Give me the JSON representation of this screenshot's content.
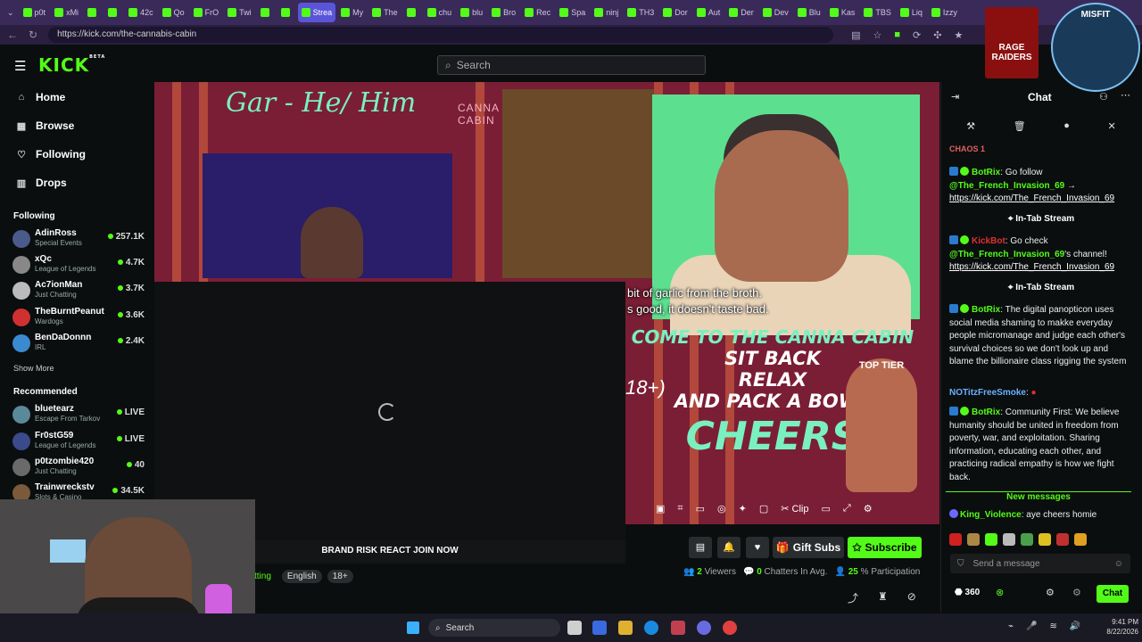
{
  "browser": {
    "tabs": [
      "p0t",
      "xMi",
      "",
      "",
      "42c",
      "Qo",
      "FrO",
      "Twi",
      "",
      "",
      "Strea",
      "My",
      "The",
      "",
      "chu",
      "blu",
      "Bro",
      "Rec",
      "Spa",
      "ninj",
      "TH3",
      "Dor",
      "Aut",
      "Der",
      "Dev",
      "Blu",
      "Kas",
      "TBS",
      "Liq",
      "Izzy"
    ],
    "active_tab_index": 10,
    "url": "https://kick.com/the-cannabis-cabin"
  },
  "kick": {
    "logo": "KICK",
    "logo_sup": "BETA",
    "search_placeholder": "Search"
  },
  "sidebar": {
    "nav": [
      "Home",
      "Browse",
      "Following",
      "Drops"
    ],
    "following_title": "Following",
    "following": [
      {
        "name": "AdinRoss",
        "category": "Special Events",
        "viewers": "257.1K"
      },
      {
        "name": "xQc",
        "category": "League of Legends",
        "viewers": "4.7K"
      },
      {
        "name": "Ac7ionMan",
        "category": "Just Chatting",
        "viewers": "3.7K"
      },
      {
        "name": "TheBurntPeanut",
        "category": "Wardogs",
        "viewers": "3.6K"
      },
      {
        "name": "BenDaDonnn",
        "category": "IRL",
        "viewers": "2.4K"
      }
    ],
    "show_more": "Show More",
    "recommended_title": "Recommended",
    "recommended": [
      {
        "name": "bluetearz",
        "category": "Escape From Tarkov",
        "viewers": "LIVE"
      },
      {
        "name": "Fr0stG59",
        "category": "League of Legends",
        "viewers": "LIVE"
      },
      {
        "name": "p0tzombie420",
        "category": "Just Chatting",
        "viewers": "40"
      },
      {
        "name": "Trainwreckstv",
        "category": "Slots & Casino",
        "viewers": "34.5K"
      }
    ]
  },
  "video": {
    "name_overlay": "Gar - He/ Him",
    "vertical_text": "CANNA CABIN",
    "subtitle_line1": "bit of garlic from the broth.",
    "subtitle_line2": "s good, it doesn't taste bad.",
    "promo_line1": "COME TO THE CANNA CABIN",
    "promo_age": "18+)",
    "promo_line2": "SIT BACK",
    "promo_line3": "RELAX",
    "promo_line4": "AND PACK A BOWL",
    "promo_cheers": "CHEERS",
    "toptier": "TOP TIER",
    "clip_label": "Clip",
    "banner": "BRAND RISK REACT JOIN NOW"
  },
  "actions": {
    "gift_subs": "Gift Subs",
    "subscribe": "Subscribe"
  },
  "stats": {
    "viewers_num": "2",
    "viewers_label": "Viewers",
    "chatters_num": "0",
    "chatters_label": "Chatters In Avg.",
    "participation_num": "25",
    "participation_label": "% Participation"
  },
  "tags": {
    "category_partial": "tting",
    "language": "English",
    "age": "18+"
  },
  "chat": {
    "title": "Chat",
    "chaos": "CHAOS 1",
    "messages": [
      {
        "user": "BotRix",
        "type": "bot",
        "text": ": Go follow ",
        "mention": "@The_French_Invasion_69",
        "suffix": " → ",
        "link": "https://kick.com/The_French_Invasion_69"
      },
      {
        "user": "KickBot",
        "type": "kb",
        "text": ": Go check ",
        "mention": "@The_French_Invasion_69",
        "suffix": "'s channel! ",
        "link": "https://kick.com/The_French_Invasion_69"
      },
      {
        "user": "BotRix",
        "type": "bot",
        "text": ": The digital panopticon uses social media shaming to makke everyday people micromanage and judge each other's survival choices so we don't look up and blame the billionaire class rigging the system"
      },
      {
        "user": "NOTitzFreeSmoke",
        "type": "usr",
        "text": ":"
      },
      {
        "user": "BotRix",
        "type": "bot",
        "text": ": Community First: We believe humanity should be united in freedom from poverty, war, and exploitation. Sharing information, educating each other, and practicing radical empathy is how we fight back."
      },
      {
        "user": "King_Violence",
        "type": "usr",
        "text": ": aye cheers homie"
      }
    ],
    "instream": "In-Tab Stream",
    "new_messages": "New messages",
    "input_placeholder": "Send a message",
    "points": "360",
    "chat_button": "Chat"
  },
  "overlays": {
    "rage": "RAGE RAIDERS",
    "misfit": "MISFIT"
  },
  "taskbar": {
    "search": "Search",
    "time": "9:41 PM",
    "date": "8/22/2026"
  }
}
